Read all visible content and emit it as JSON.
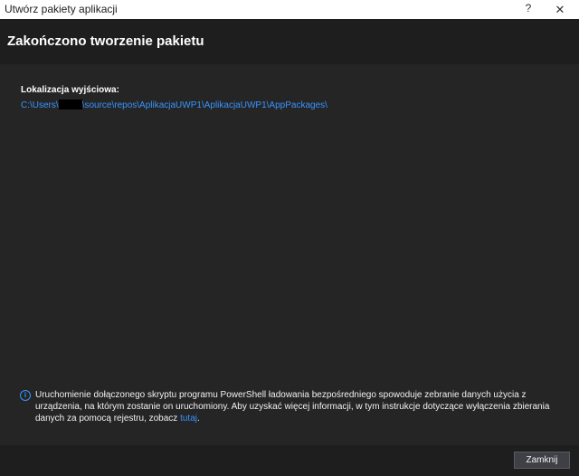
{
  "window": {
    "title": "Utwórz pakiety aplikacji",
    "help_glyph": "?",
    "close_glyph": "✕"
  },
  "header": {
    "title": "Zakończono tworzenie pakietu"
  },
  "output": {
    "label": "Lokalizacja wyjściowa:",
    "path_prefix": "C:\\Users\\",
    "path_suffix": "\\source\\repos\\AplikacjaUWP1\\AplikacjaUWP1\\AppPackages\\"
  },
  "info": {
    "icon": "info-icon",
    "text": "Uruchomienie dołączonego skryptu programu PowerShell ładowania bezpośredniego spowoduje zebranie danych użycia z urządzenia, na którym zostanie on uruchomiony. Aby uzyskać więcej informacji, w tym instrukcje dotyczące wyłączenia zbierania danych za pomocą rejestru, zobacz ",
    "link": "tutaj",
    "suffix": "."
  },
  "footer": {
    "close_label": "Zamknij"
  },
  "colors": {
    "accent_link": "#3794ff",
    "background": "#252526",
    "header_bg": "#1e1e1e"
  }
}
